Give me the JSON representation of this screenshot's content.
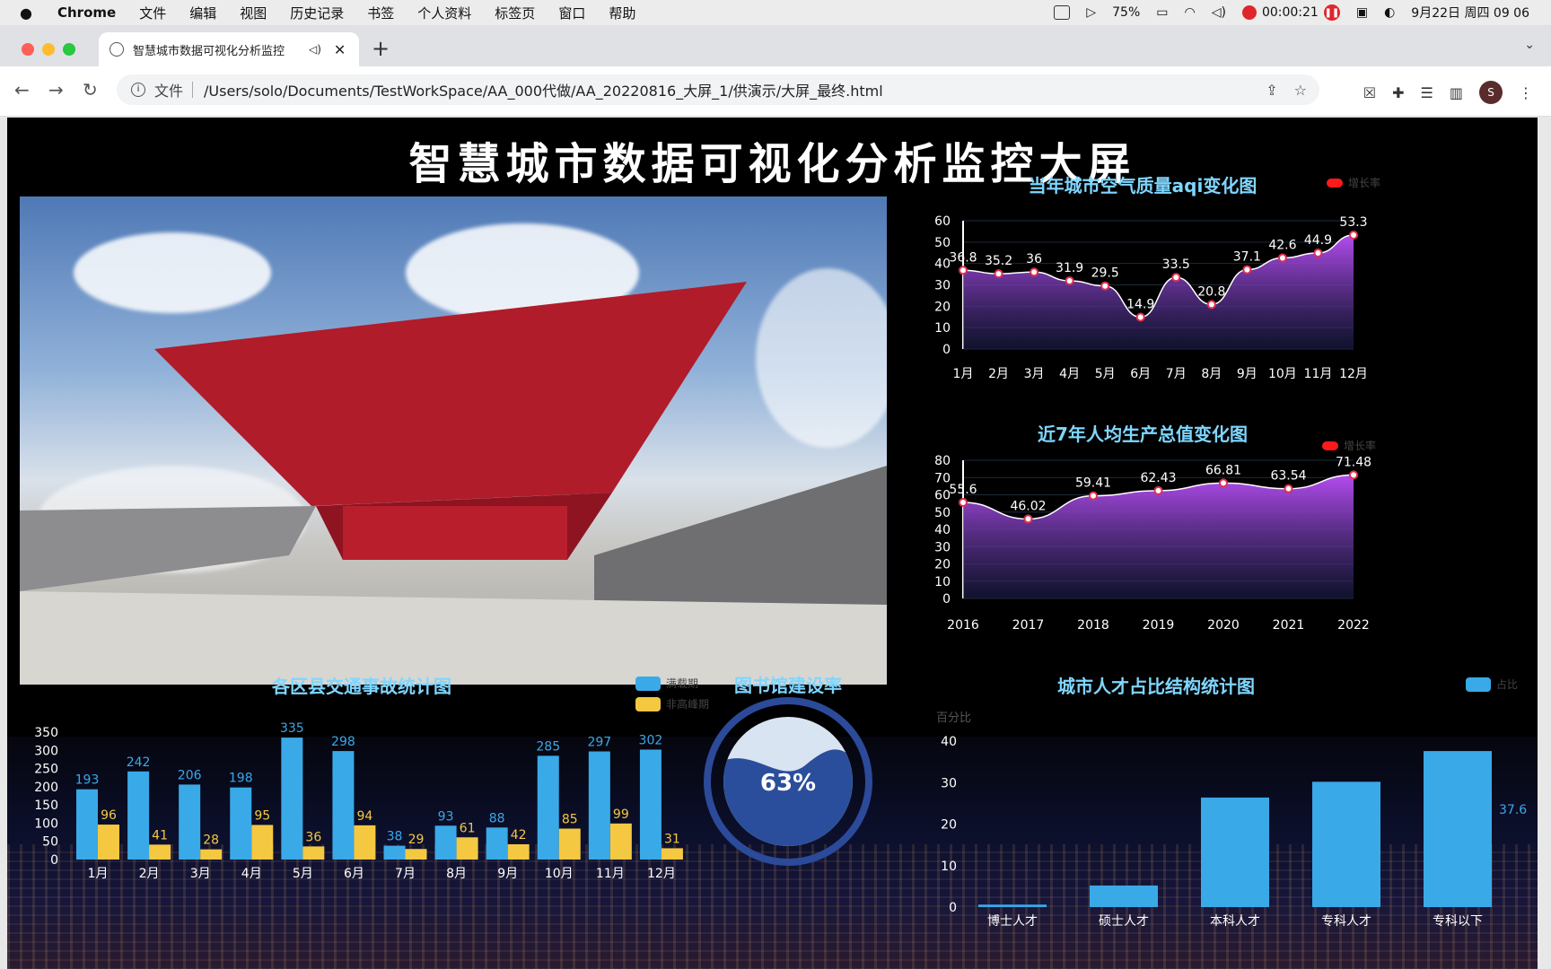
{
  "menubar": {
    "app": "Chrome",
    "items": [
      "文件",
      "编辑",
      "视图",
      "历史记录",
      "书签",
      "个人资料",
      "标签页",
      "窗口",
      "帮助"
    ],
    "battery": "75%",
    "recording_time": "00:00:21",
    "datetime": "9月22日 周四  09 06"
  },
  "browser": {
    "tab_title": "智慧城市数据可视化分析监控",
    "url_label": "文件",
    "url": "/Users/solo/Documents/TestWorkSpace/AA_000代做/AA_20220816_大屏_1/供演示/大屏_最终.html",
    "profile_initial": "S"
  },
  "dashboard": {
    "title": "智慧城市数据可视化分析监控大屏",
    "aqi": {
      "title": "当年城市空气质量aqi变化图",
      "legend": "增长率",
      "legend_color": "#ff1a1a",
      "line_color": "#a23ce6",
      "categories": [
        "1月",
        "2月",
        "3月",
        "4月",
        "5月",
        "6月",
        "7月",
        "8月",
        "9月",
        "10月",
        "11月",
        "12月"
      ],
      "values": [
        36.8,
        35.2,
        36,
        31.9,
        29.5,
        14.9,
        33.5,
        20.8,
        37.1,
        42.6,
        44.9,
        53.3
      ],
      "yticks": [
        "60",
        "50",
        "40",
        "30",
        "20",
        "10",
        "0"
      ]
    },
    "gdp": {
      "title": "近7年人均生产总值变化图",
      "legend": "增长率",
      "legend_color": "#ff1a1a",
      "categories": [
        "2016",
        "2017",
        "2018",
        "2019",
        "2020",
        "2021",
        "2022"
      ],
      "values": [
        55.6,
        46.02,
        59.41,
        62.43,
        66.81,
        63.54,
        71.48
      ],
      "yticks": [
        "80",
        "70",
        "60",
        "50",
        "40",
        "30",
        "20",
        "10",
        "0"
      ]
    },
    "traffic": {
      "title": "各区县交通事故统计图",
      "legend": [
        "满载期",
        "非高峰期"
      ],
      "colors": [
        "#3aa9e8",
        "#f5c842"
      ],
      "categories": [
        "1月",
        "2月",
        "3月",
        "4月",
        "5月",
        "6月",
        "7月",
        "8月",
        "9月",
        "10月",
        "11月",
        "12月"
      ],
      "series_a": [
        193,
        242,
        206,
        198,
        335,
        298,
        38,
        93,
        88,
        285,
        297,
        302
      ],
      "series_b": [
        96,
        41,
        28,
        95,
        36,
        94,
        29,
        61,
        42,
        85,
        99,
        31
      ],
      "yticks": [
        "350",
        "300",
        "250",
        "200",
        "150",
        "100",
        "50",
        "0"
      ]
    },
    "library": {
      "title": "图书馆建设率",
      "value": 0.63,
      "label": "63%"
    },
    "talent": {
      "title": "城市人才占比结构统计图",
      "legend": "占比",
      "ylabel": "百分比",
      "categories": [
        "博士人才",
        "硕士人才",
        "本科人才",
        "专科人才",
        "专科以下"
      ],
      "values": [
        0.6,
        5.2,
        26.4,
        30.2,
        37.6
      ],
      "yticks": [
        "40",
        "30",
        "20",
        "10",
        "0"
      ],
      "last_value_label": "37.6",
      "bar_color": "#3aa9e8"
    }
  }
}
